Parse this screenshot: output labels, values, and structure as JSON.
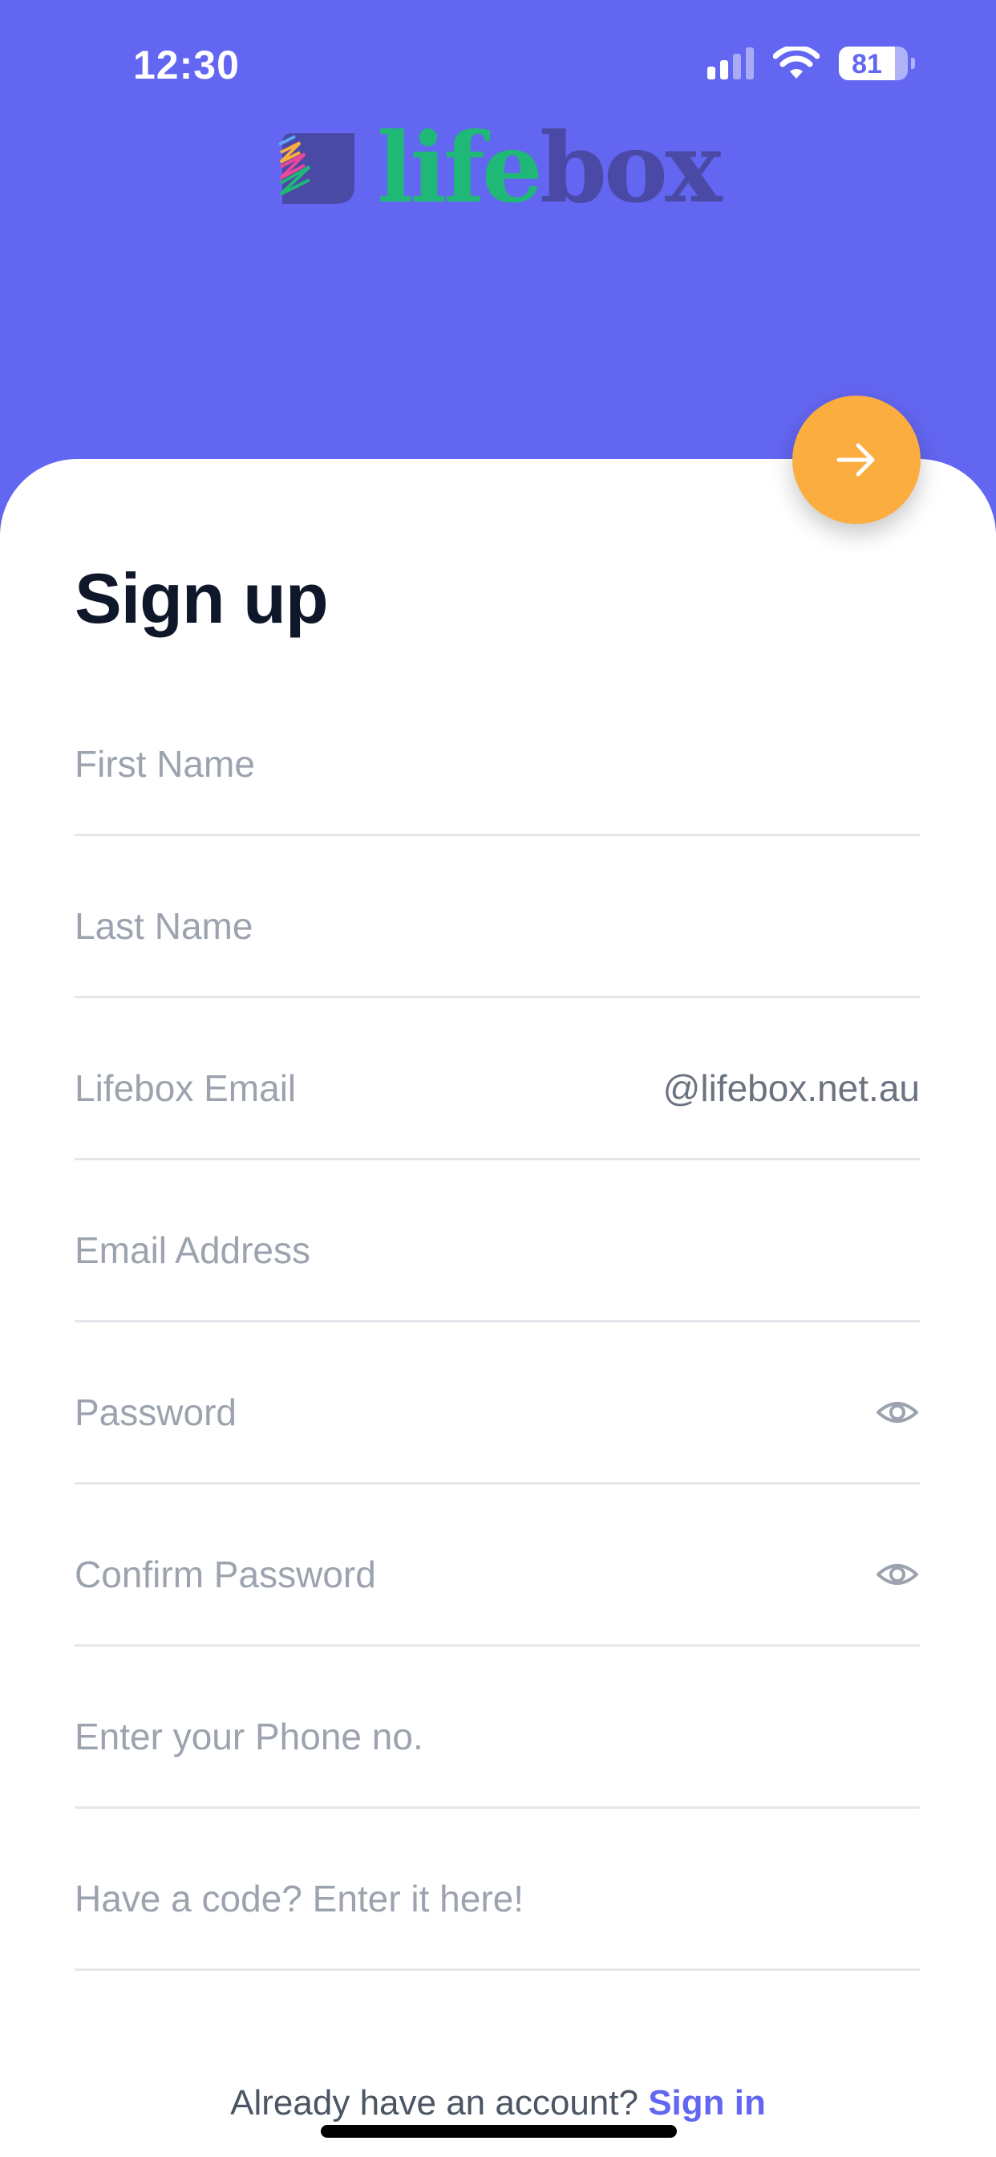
{
  "status_bar": {
    "time": "12:30",
    "battery": "81"
  },
  "logo": {
    "part1": "life",
    "part2": "box"
  },
  "form": {
    "title": "Sign up",
    "first_name": {
      "placeholder": "First Name",
      "value": ""
    },
    "last_name": {
      "placeholder": "Last Name",
      "value": ""
    },
    "lifebox_email": {
      "placeholder": "Lifebox Email",
      "value": "",
      "suffix": "@lifebox.net.au"
    },
    "email": {
      "placeholder": "Email Address",
      "value": ""
    },
    "password": {
      "placeholder": "Password",
      "value": ""
    },
    "confirm_password": {
      "placeholder": "Confirm Password",
      "value": ""
    },
    "phone": {
      "placeholder": "Enter your Phone no.",
      "value": ""
    },
    "code": {
      "placeholder": "Have a code? Enter it here!",
      "value": ""
    }
  },
  "footer": {
    "prompt": "Already have an account?",
    "link": "Sign in"
  },
  "icons": {
    "submit": "arrow-right-icon",
    "show_password": "eye-icon"
  },
  "colors": {
    "primary": "#6366f0",
    "accent": "#fbad40",
    "logo_green": "#1fb876",
    "logo_purple": "#4b49a6"
  }
}
